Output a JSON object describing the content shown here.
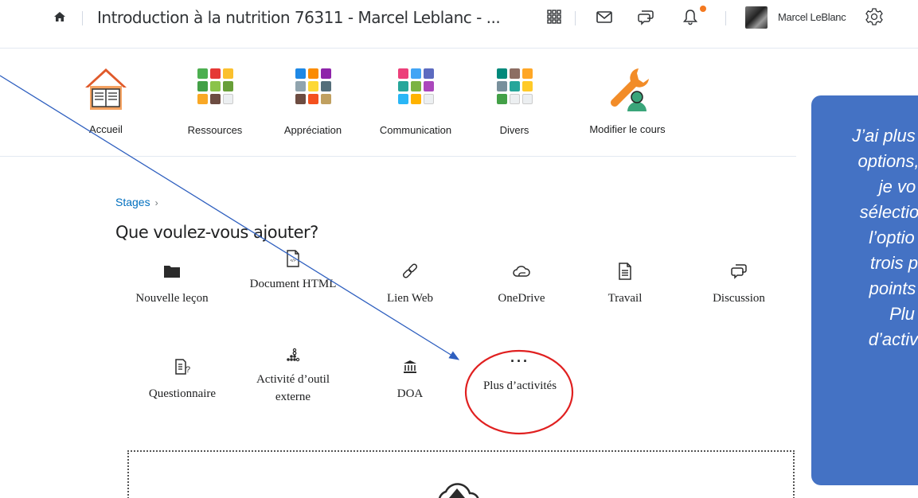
{
  "topbar": {
    "course_title": "Introduction à la nutrition 76311 - Marcel Leblanc - ...",
    "user_name": "Marcel LeBlanc",
    "notification_color": "#f47920",
    "icons": [
      "home-icon",
      "apps-grid-icon",
      "mail-icon",
      "chat-icon",
      "bell-icon",
      "avatar",
      "gear-icon"
    ]
  },
  "nav": {
    "items": [
      {
        "label": "Accueil",
        "icon": "house-book-icon"
      },
      {
        "label": "Ressources",
        "icon": "resources-grid-icon"
      },
      {
        "label": "Appréciation",
        "icon": "assessment-grid-icon"
      },
      {
        "label": "Communication",
        "icon": "communication-grid-icon"
      },
      {
        "label": "Divers",
        "icon": "misc-grid-icon"
      },
      {
        "label": "Modifier le cours",
        "icon": "wrench-person-icon"
      }
    ]
  },
  "content": {
    "breadcrumb": "Stages",
    "heading": "Que voulez-vous ajouter?",
    "activities": [
      {
        "label": "Nouvelle leçon",
        "icon": "folder-icon"
      },
      {
        "label": "Document HTML",
        "icon": "html-document-icon"
      },
      {
        "label": "Lien Web",
        "icon": "link-icon"
      },
      {
        "label": "OneDrive",
        "icon": "cloud-icon"
      },
      {
        "label": "Travail",
        "icon": "assignment-icon"
      },
      {
        "label": "Discussion",
        "icon": "discussion-icon"
      },
      {
        "label": "Questionnaire",
        "icon": "quiz-icon"
      },
      {
        "label": "Activité d’outil externe",
        "icon": "external-tool-icon"
      },
      {
        "label": "DOA",
        "icon": "institution-icon"
      },
      {
        "label": "Plus d’activités",
        "icon": "more-dots-icon"
      }
    ]
  },
  "annotation": {
    "callout_lines": [
      "J’ai plus",
      "options,",
      "je vo",
      "sélectio",
      "l’optio",
      "trois p",
      "points",
      "Plu",
      "d’activ"
    ],
    "callout_color": "#4472c4",
    "circle_color": "#e02020",
    "arrow_color": "#2e5fbf"
  }
}
